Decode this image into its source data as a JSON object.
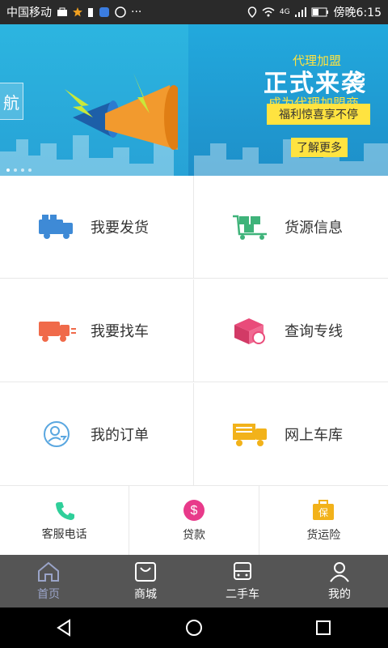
{
  "status": {
    "carrier": "中国移动",
    "network": "4G",
    "time": "傍晚6:15"
  },
  "banner": {
    "nav_tag": "航",
    "agent": "代理加盟",
    "title": "正式来袭",
    "subtitle": "成为代理加盟商",
    "welfare": "福利惊喜享不停",
    "more": "了解更多"
  },
  "grid": {
    "items": [
      {
        "label": "我要发货"
      },
      {
        "label": "货源信息"
      },
      {
        "label": "我要找车"
      },
      {
        "label": "查询专线"
      },
      {
        "label": "我的订单"
      },
      {
        "label": "网上车库"
      }
    ]
  },
  "quick": {
    "items": [
      {
        "label": "客服电话"
      },
      {
        "label": "贷款"
      },
      {
        "label": "货运险"
      }
    ]
  },
  "tabs": [
    {
      "label": "首页"
    },
    {
      "label": "商城"
    },
    {
      "label": "二手车"
    },
    {
      "label": "我的"
    }
  ],
  "colors": {
    "accent_active": "#9aa4c8",
    "banner_yellow": "#ffe340"
  }
}
